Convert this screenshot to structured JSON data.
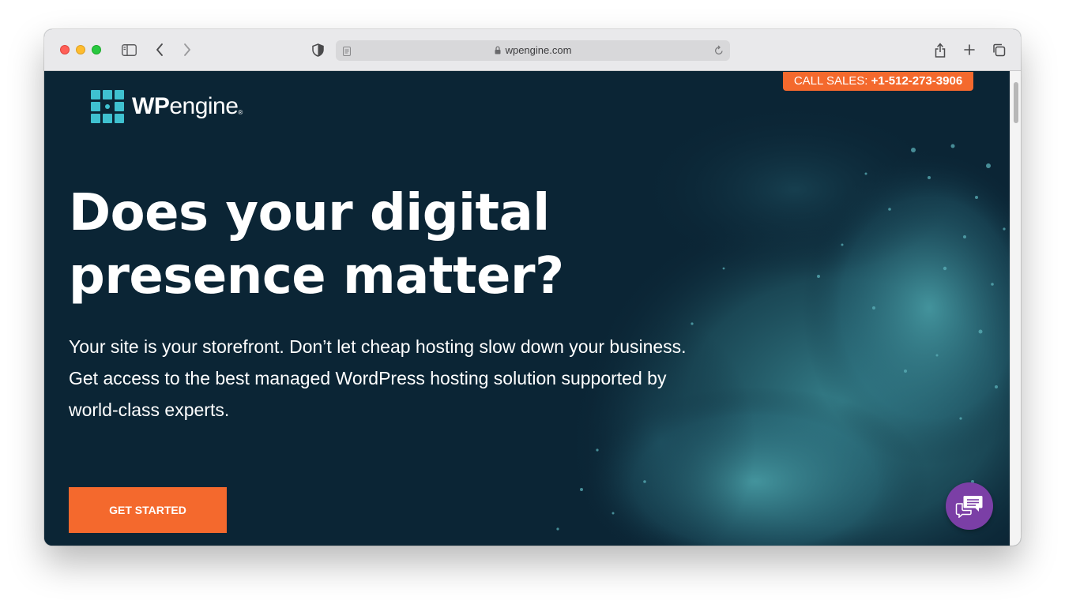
{
  "browser": {
    "url": "wpengine.com",
    "icons": {
      "sidebar": "sidebar-icon",
      "back": "chevron-left-icon",
      "forward": "chevron-right-icon",
      "privacy": "shield-icon",
      "reader": "reader-icon",
      "lock": "lock-icon",
      "reload": "reload-icon",
      "share": "share-icon",
      "new_tab": "plus-icon",
      "tabs": "tabs-overview-icon"
    }
  },
  "header": {
    "call_sales_label": "CALL SALES:",
    "call_sales_phone": "+1-512-273-3906",
    "logo": {
      "wp": "WP",
      "engine": "engine",
      "mark": "®"
    }
  },
  "hero": {
    "headline_line1": "Does your digital",
    "headline_line2": "presence matter?",
    "sub_line1": "Your site is your storefront. Don’t let cheap hosting slow down your business.",
    "sub_line2": "Get access to the best managed WordPress hosting solution supported by",
    "sub_line3": "world-class experts.",
    "cta_label": "GET STARTED"
  },
  "colors": {
    "page_bg": "#0b2535",
    "accent": "#f4692d",
    "logo_teal": "#3fc1d0",
    "chat_purple": "#7b3fa6"
  },
  "chat": {
    "icon": "chat-bubbles-icon"
  }
}
